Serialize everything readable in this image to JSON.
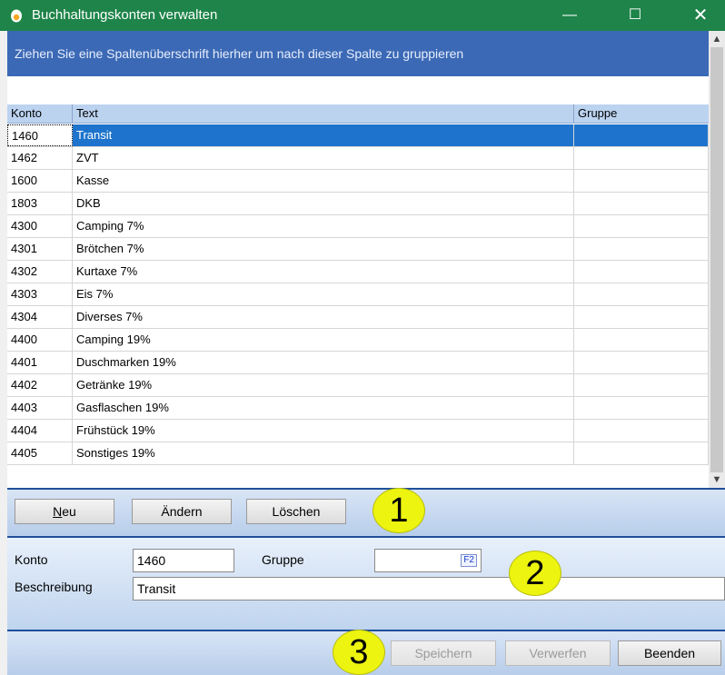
{
  "window": {
    "title": "Buchhaltungskonten verwalten",
    "minimize": "—",
    "maximize": "☐",
    "close": "✕"
  },
  "grid": {
    "group_hint": "Ziehen Sie eine Spaltenüberschrift hierher um nach dieser Spalte zu gruppieren",
    "columns": [
      "Konto",
      "Text",
      "Gruppe"
    ],
    "rows": [
      {
        "konto": "1460",
        "text": "Transit",
        "gruppe": ""
      },
      {
        "konto": "1462",
        "text": "ZVT",
        "gruppe": ""
      },
      {
        "konto": "1600",
        "text": "Kasse",
        "gruppe": ""
      },
      {
        "konto": "1803",
        "text": "DKB",
        "gruppe": ""
      },
      {
        "konto": "4300",
        "text": "Camping 7%",
        "gruppe": ""
      },
      {
        "konto": "4301",
        "text": "Brötchen 7%",
        "gruppe": ""
      },
      {
        "konto": "4302",
        "text": "Kurtaxe 7%",
        "gruppe": ""
      },
      {
        "konto": "4303",
        "text": "Eis 7%",
        "gruppe": ""
      },
      {
        "konto": "4304",
        "text": "Diverses 7%",
        "gruppe": ""
      },
      {
        "konto": "4400",
        "text": "Camping 19%",
        "gruppe": ""
      },
      {
        "konto": "4401",
        "text": "Duschmarken 19%",
        "gruppe": ""
      },
      {
        "konto": "4402",
        "text": "Getränke 19%",
        "gruppe": ""
      },
      {
        "konto": "4403",
        "text": "Gasflaschen 19%",
        "gruppe": ""
      },
      {
        "konto": "4404",
        "text": "Frühstück 19%",
        "gruppe": ""
      },
      {
        "konto": "4405",
        "text": "Sonstiges 19%",
        "gruppe": ""
      }
    ],
    "selected_index": 0
  },
  "actions": {
    "neu": "Neu",
    "aendern": "Ändern",
    "loeschen": "Löschen"
  },
  "form": {
    "konto_label": "Konto",
    "konto_value": "1460",
    "gruppe_label": "Gruppe",
    "gruppe_value": "",
    "f2_hint": "F2",
    "beschreibung_label": "Beschreibung",
    "beschreibung_value": "Transit"
  },
  "footer": {
    "speichern": "Speichern",
    "verwerfen": "Verwerfen",
    "beenden": "Beenden"
  },
  "markers": [
    "1",
    "2",
    "3"
  ],
  "colors": {
    "titlebar": "#1e8449",
    "group_panel": "#3b69b5",
    "selection": "#1e74cc",
    "marker": "#ecf40f"
  }
}
